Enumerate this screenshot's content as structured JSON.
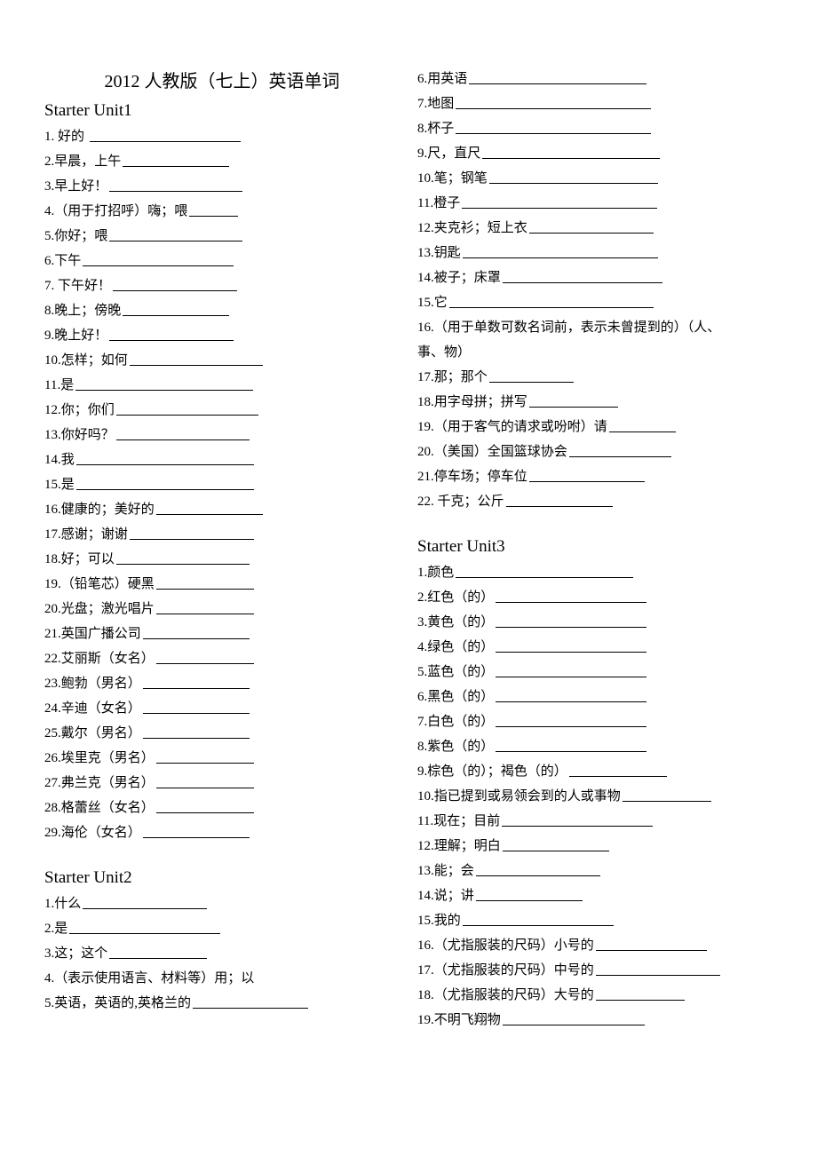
{
  "title": "2012 人教版（七上）英语单词",
  "left": [
    {
      "type": "head",
      "text": "Starter Unit1"
    },
    {
      "type": "item",
      "text": "1. 好的 ",
      "blank": 170
    },
    {
      "type": "item",
      "text": "2.早晨，上午",
      "blank": 120
    },
    {
      "type": "item",
      "text": "3.早上好！",
      "blank": 150
    },
    {
      "type": "item",
      "text": "4.（用于打招呼）嗨；喂",
      "blank": 55
    },
    {
      "type": "item",
      "text": "5.你好；喂",
      "blank": 150
    },
    {
      "type": "item",
      "text": "6.下午",
      "blank": 170
    },
    {
      "type": "item",
      "text": "7. 下午好！",
      "blank": 140
    },
    {
      "type": "item",
      "text": "8.晚上；傍晚",
      "blank": 120
    },
    {
      "type": "item",
      "text": "9.晚上好！",
      "blank": 140
    },
    {
      "type": "item",
      "text": "10.怎样；如何",
      "blank": 150
    },
    {
      "type": "item",
      "text": "11.是",
      "blank": 200
    },
    {
      "type": "item",
      "text": "12.你；你们",
      "blank": 160
    },
    {
      "type": "item",
      "text": "13.你好吗？",
      "blank": 150
    },
    {
      "type": "item",
      "text": "14.我",
      "blank": 200
    },
    {
      "type": "item",
      "text": "15.是",
      "blank": 200
    },
    {
      "type": "item",
      "text": "16.健康的；美好的",
      "blank": 120
    },
    {
      "type": "item",
      "text": "17.感谢；谢谢",
      "blank": 140
    },
    {
      "type": "item",
      "text": "18.好；可以",
      "blank": 150
    },
    {
      "type": "item",
      "text": "19.（铅笔芯）硬黑",
      "blank": 110
    },
    {
      "type": "item",
      "text": "20.光盘；激光唱片",
      "blank": 110
    },
    {
      "type": "item",
      "text": "21.英国广播公司",
      "blank": 120
    },
    {
      "type": "item",
      "text": "22.艾丽斯（女名）",
      "blank": 110
    },
    {
      "type": "item",
      "text": "23.鲍勃（男名）",
      "blank": 120
    },
    {
      "type": "item",
      "text": "24.辛迪（女名）",
      "blank": 120
    },
    {
      "type": "item",
      "text": "25.戴尔（男名）",
      "blank": 120
    },
    {
      "type": "item",
      "text": "26.埃里克（男名）",
      "blank": 110
    },
    {
      "type": "item",
      "text": "27.弗兰克（男名）",
      "blank": 110
    },
    {
      "type": "item",
      "text": "28.格蕾丝（女名）",
      "blank": 110
    },
    {
      "type": "item",
      "text": "29.海伦（女名）",
      "blank": 120
    },
    {
      "type": "spacer"
    },
    {
      "type": "head",
      "text": "Starter Unit2"
    },
    {
      "type": "item",
      "text": "1.什么",
      "blank": 140
    },
    {
      "type": "item",
      "text": "2.是",
      "blank": 170
    },
    {
      "type": "item",
      "text": "3.这；这个",
      "blank": 110
    },
    {
      "type": "item",
      "text": "4.（表示使用语言、材料等）用；以",
      "blank": 0,
      "noline": true
    },
    {
      "type": "item",
      "text": "5.英语，英语的,英格兰的",
      "blank": 130
    }
  ],
  "right": [
    {
      "type": "item",
      "text": "6.用英语",
      "blank": 200
    },
    {
      "type": "item",
      "text": "7.地图",
      "blank": 220
    },
    {
      "type": "item",
      "text": "8.杯子",
      "blank": 220
    },
    {
      "type": "item",
      "text": "9.尺，直尺",
      "blank": 200
    },
    {
      "type": "item",
      "text": "10.笔；钢笔",
      "blank": 190
    },
    {
      "type": "item",
      "text": "11.橙子",
      "blank": 220
    },
    {
      "type": "item",
      "text": "12.夹克衫；短上衣",
      "blank": 140
    },
    {
      "type": "item",
      "text": "13.钥匙",
      "blank": 220
    },
    {
      "type": "item",
      "text": "14.被子；床罩",
      "blank": 180
    },
    {
      "type": "item",
      "text": "15.它",
      "blank": 230
    },
    {
      "type": "item",
      "text": "16.（用于单数可数名词前，表示未曾提到的）（人、",
      "blank": 0,
      "noline": true
    },
    {
      "type": "item",
      "text": "事、物）",
      "blank": 0,
      "noline": true
    },
    {
      "type": "item",
      "text": "17.那；那个",
      "blank": 95
    },
    {
      "type": "item",
      "text": "18.用字母拼；拼写",
      "blank": 100
    },
    {
      "type": "item",
      "text": "19.（用于客气的请求或吩咐）请",
      "blank": 75
    },
    {
      "type": "item",
      "text": "20.（美国）全国篮球协会",
      "blank": 115
    },
    {
      "type": "item",
      "text": "21.停车场；停车位",
      "blank": 130
    },
    {
      "type": "item",
      "text": "22. 千克；公斤",
      "blank": 120
    },
    {
      "type": "spacer"
    },
    {
      "type": "head",
      "text": "Starter Unit3"
    },
    {
      "type": "item",
      "text": "1.颜色",
      "blank": 200
    },
    {
      "type": "item",
      "text": "2.红色（的）",
      "blank": 170
    },
    {
      "type": "item",
      "text": "3.黄色（的）",
      "blank": 170
    },
    {
      "type": "item",
      "text": "4.绿色（的）",
      "blank": 170
    },
    {
      "type": "item",
      "text": "5.蓝色（的）",
      "blank": 170
    },
    {
      "type": "item",
      "text": "6.黑色（的）",
      "blank": 170
    },
    {
      "type": "item",
      "text": "7.白色（的）",
      "blank": 170
    },
    {
      "type": "item",
      "text": "8.紫色（的）",
      "blank": 170
    },
    {
      "type": "item",
      "text": "9.棕色（的）；褐色（的）",
      "blank": 110
    },
    {
      "type": "item",
      "text": "10.指已提到或易领会到的人或事物",
      "blank": 100
    },
    {
      "type": "item",
      "text": "11.现在；目前",
      "blank": 170
    },
    {
      "type": "item",
      "text": "12.理解；明白",
      "blank": 120
    },
    {
      "type": "item",
      "text": "13.能；会",
      "blank": 140
    },
    {
      "type": "item",
      "text": "14.说；讲",
      "blank": 120
    },
    {
      "type": "item",
      "text": "15.我的",
      "blank": 170
    },
    {
      "type": "item",
      "text": "16.（尤指服装的尺码）小号的",
      "blank": 125
    },
    {
      "type": "item",
      "text": "17.（尤指服装的尺码）中号的",
      "blank": 140
    },
    {
      "type": "item",
      "text": "18.（尤指服装的尺码）大号的",
      "blank": 100
    },
    {
      "type": "item",
      "text": "19.不明飞翔物",
      "blank": 160
    }
  ]
}
